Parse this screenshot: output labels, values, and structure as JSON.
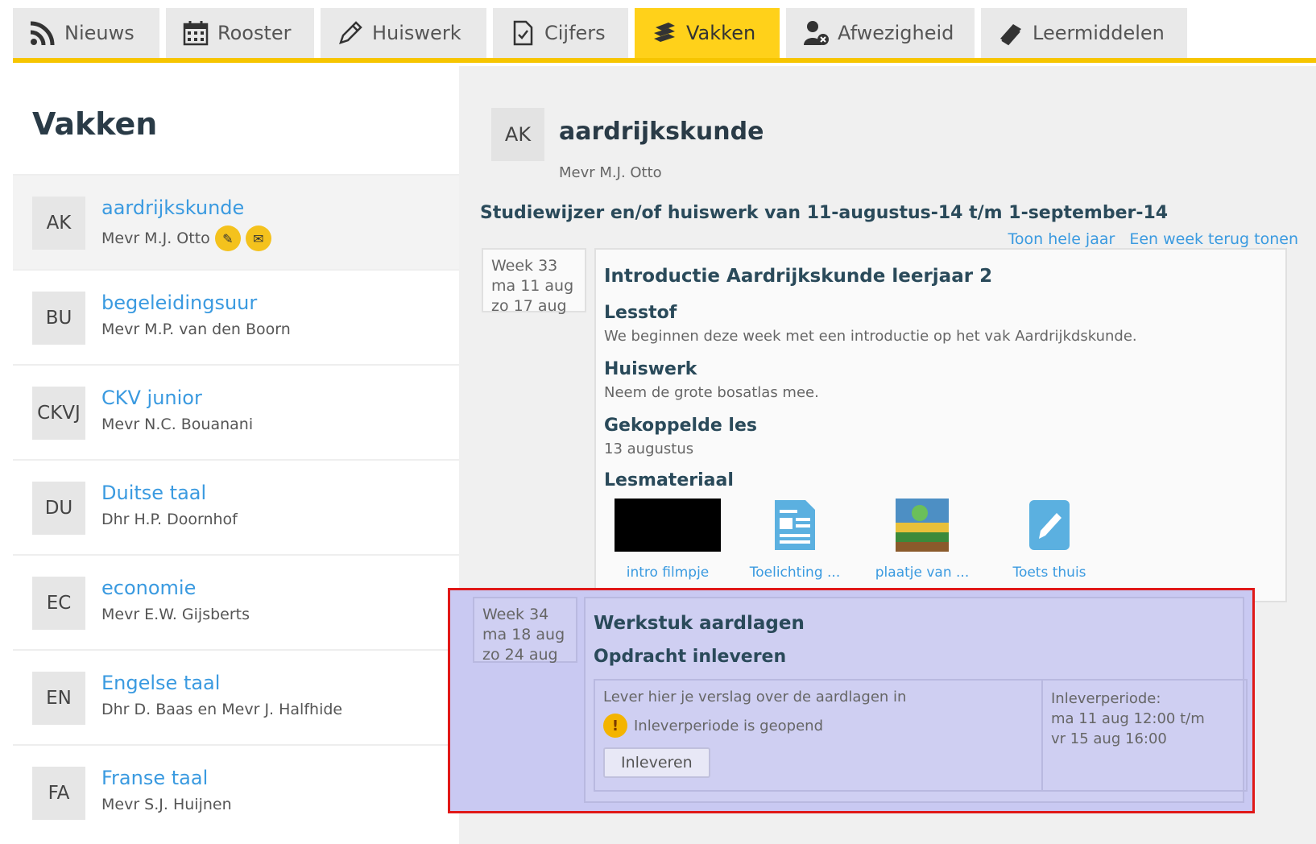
{
  "tabs": [
    {
      "label": "Nieuws",
      "icon": "rss-icon"
    },
    {
      "label": "Rooster",
      "icon": "calendar-icon"
    },
    {
      "label": "Huiswerk",
      "icon": "pencil-icon"
    },
    {
      "label": "Cijfers",
      "icon": "document-check-icon"
    },
    {
      "label": "Vakken",
      "icon": "books-icon",
      "active": true
    },
    {
      "label": "Afwezigheid",
      "icon": "user-absent-icon"
    },
    {
      "label": "Leermiddelen",
      "icon": "book-icon"
    }
  ],
  "left": {
    "title": "Vakken",
    "subjects": [
      {
        "abbr": "AK",
        "name": "aardrijkskunde",
        "teacher": "Mevr M.J. Otto",
        "selected": true
      },
      {
        "abbr": "BU",
        "name": "begeleidingsuur",
        "teacher": "Mevr M.P. van den Boorn"
      },
      {
        "abbr": "CKVJ",
        "name": "CKV junior",
        "teacher": "Mevr N.C. Bouanani"
      },
      {
        "abbr": "DU",
        "name": "Duitse taal",
        "teacher": "Dhr H.P. Doornhof"
      },
      {
        "abbr": "EC",
        "name": "economie",
        "teacher": "Mevr E.W. Gijsberts"
      },
      {
        "abbr": "EN",
        "name": "Engelse taal",
        "teacher": "Dhr D. Baas en Mevr J. Halfhide"
      },
      {
        "abbr": "FA",
        "name": "Franse taal",
        "teacher": "Mevr S.J. Huijnen"
      }
    ]
  },
  "detail": {
    "abbr": "AK",
    "title": "aardrijkskunde",
    "teacher": "Mevr M.J. Otto",
    "studiewijzer": "Studiewijzer en/of huiswerk van 11-augustus-14 t/m 1-september-14",
    "links": {
      "full_year": "Toon hele jaar",
      "week_back": "Een week terug tonen"
    },
    "week33": {
      "week": "Week 33",
      "start": "ma 11 aug",
      "end": "zo 17 aug",
      "title": "Introductie Aardrijkskunde leerjaar 2",
      "lesstof_head": "Lesstof",
      "lesstof": "We beginnen deze week met een introductie op het vak Aardrijkdskunde.",
      "huiswerk_head": "Huiswerk",
      "huiswerk": "Neem de grote bosatlas mee.",
      "les_head": "Gekoppelde les",
      "les": "13 augustus",
      "materiaal_head": "Lesmateriaal",
      "materials": [
        {
          "label": "intro filmpje"
        },
        {
          "label": "Toelichting ..."
        },
        {
          "label": "plaatje van ..."
        },
        {
          "label": "Toets thuis"
        }
      ]
    },
    "week34": {
      "week": "Week 34",
      "start": "ma 18 aug",
      "end": "zo 24 aug",
      "title": "Werkstuk aardlagen",
      "assign_head": "Opdracht inleveren",
      "assign_text": "Lever hier je verslag over de aardlagen in",
      "warning": "Inleverperiode is geopend",
      "button": "Inleveren",
      "period_label": "Inleverperiode:",
      "period_start": "ma 11 aug 12:00 t/m",
      "period_end": "vr 15 aug 16:00"
    }
  },
  "colors": {
    "accent": "#ffd11a",
    "link": "#3a9ae0",
    "highlight": "#c9c9f2",
    "highlight_border": "#e01818"
  }
}
